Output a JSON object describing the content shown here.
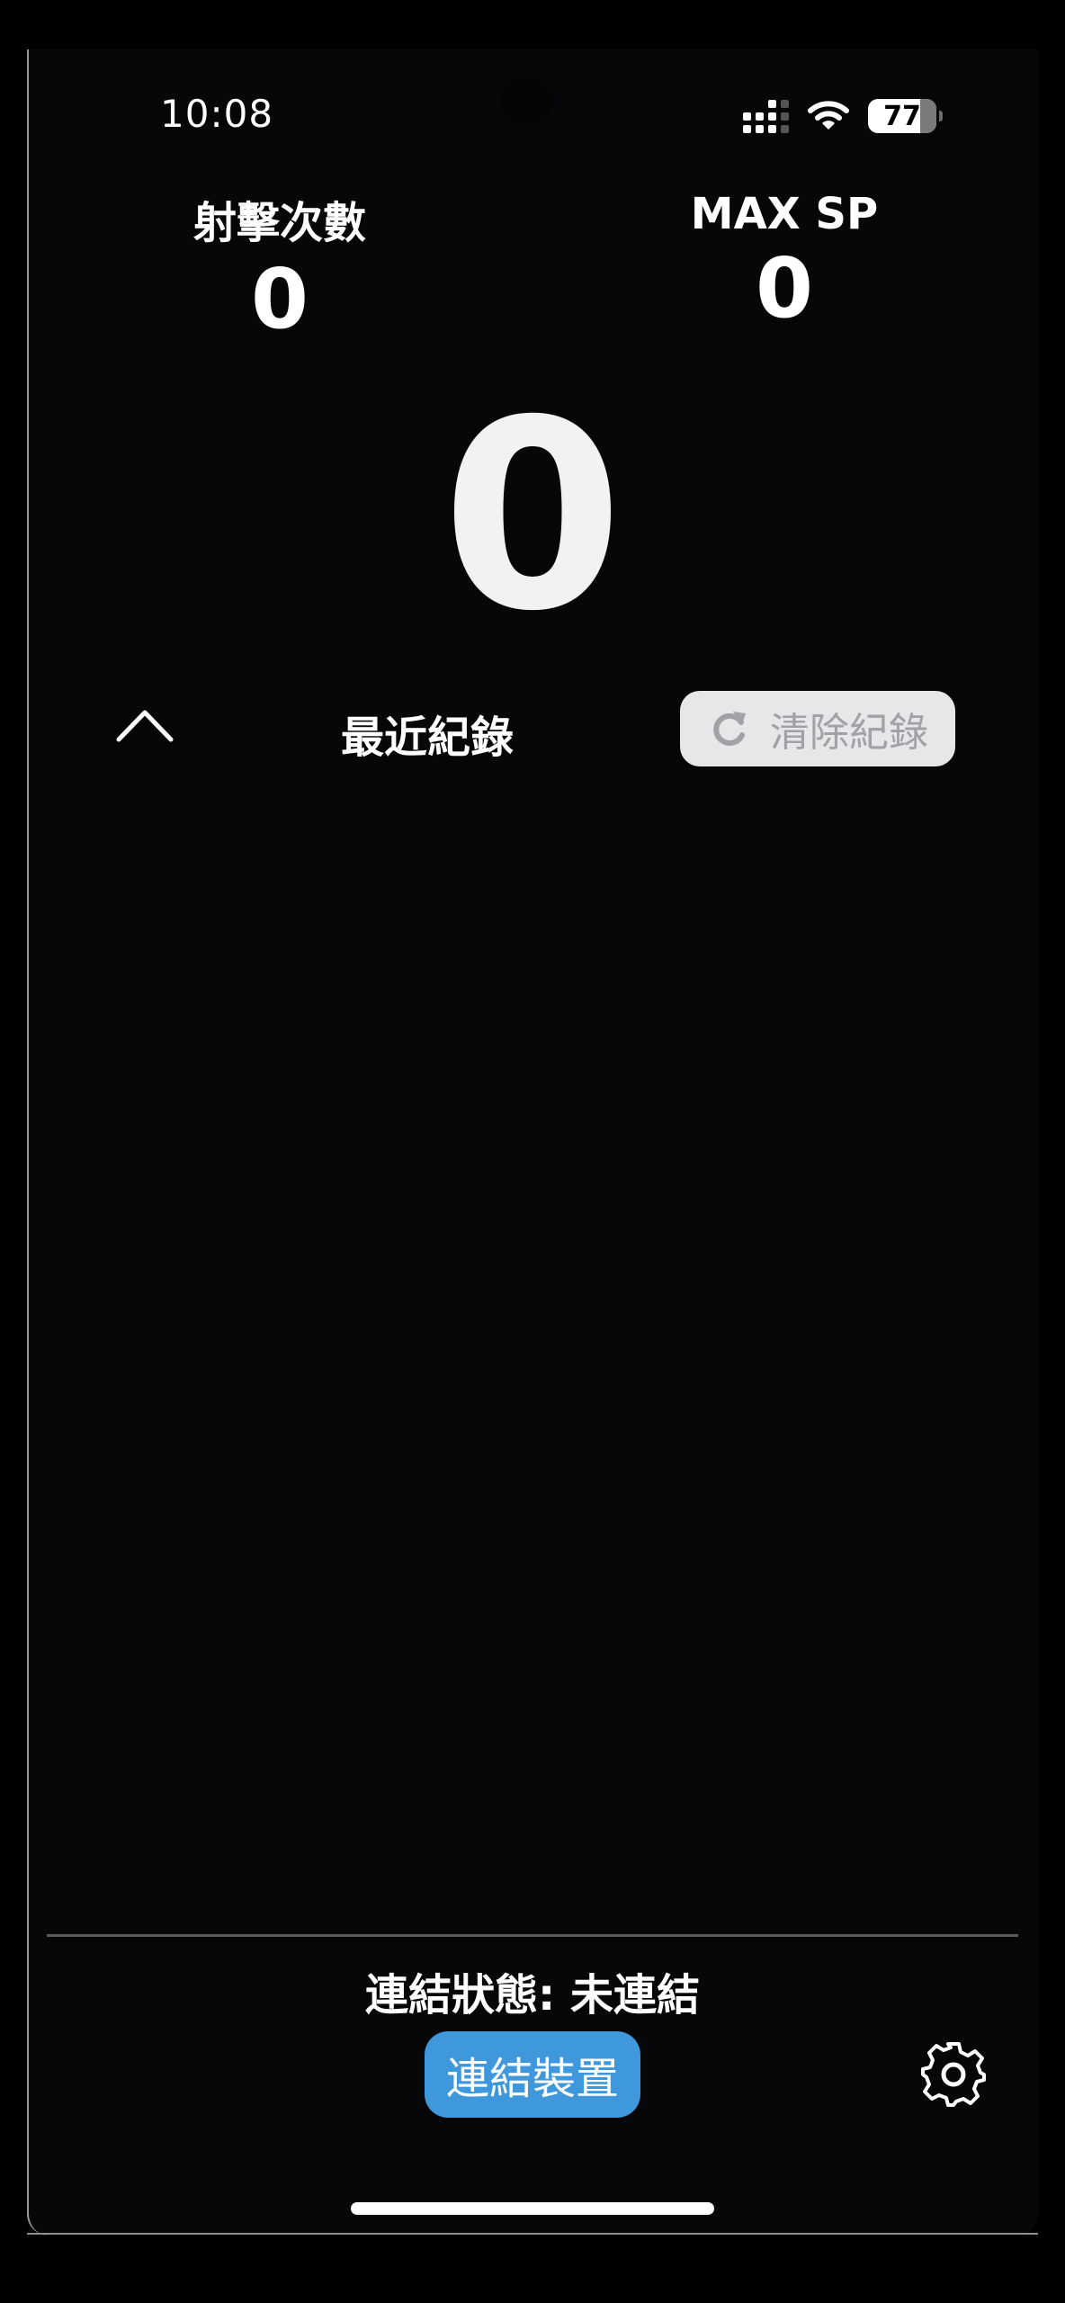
{
  "status_bar": {
    "time": "10:08",
    "battery_level": "77",
    "icons": [
      "signal-icon",
      "wifi-icon",
      "battery-icon"
    ]
  },
  "stats": {
    "shots_label": "射擊次數",
    "shots_value": "0",
    "max_sp_label": "MAX SP",
    "max_sp_value": "0"
  },
  "main_display": {
    "value": "0"
  },
  "records": {
    "title": "最近紀錄",
    "collapse_icon": "chevron-up-icon",
    "clear_label": "清除紀錄",
    "clear_icon": "refresh-icon",
    "items": []
  },
  "footer": {
    "connection_status": "連結狀態: 未連結",
    "connect_label": "連結裝置",
    "settings_icon": "gear-icon"
  },
  "colors": {
    "background": "#07070a",
    "accent": "#3f97dc",
    "clear_button_bg": "#e7e7ea",
    "clear_button_text": "#a2a2a6"
  }
}
